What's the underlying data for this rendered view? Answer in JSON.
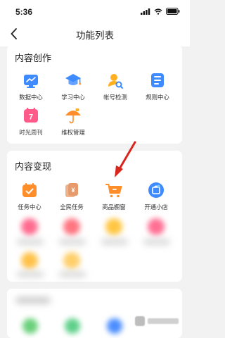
{
  "status_bar": {
    "time": "5:36"
  },
  "header": {
    "title": "功能列表"
  },
  "content_creation": {
    "title": "内容创作",
    "items": [
      {
        "label": "数据中心"
      },
      {
        "label": "学习中心"
      },
      {
        "label": "帐号检测"
      },
      {
        "label": "规则中心"
      },
      {
        "label": "时光周刊",
        "icon_text": "7"
      },
      {
        "label": "维权管理"
      }
    ]
  },
  "content_monetization": {
    "title": "内容变现",
    "items": [
      {
        "label": "任务中心"
      },
      {
        "label": "全民任务"
      },
      {
        "label": "商品橱窗"
      },
      {
        "label": "开通小店"
      }
    ]
  },
  "colors": {
    "accent_blue": "#3d8bff",
    "accent_orange": "#ff8d2a",
    "arrow_red": "#d8261c"
  }
}
